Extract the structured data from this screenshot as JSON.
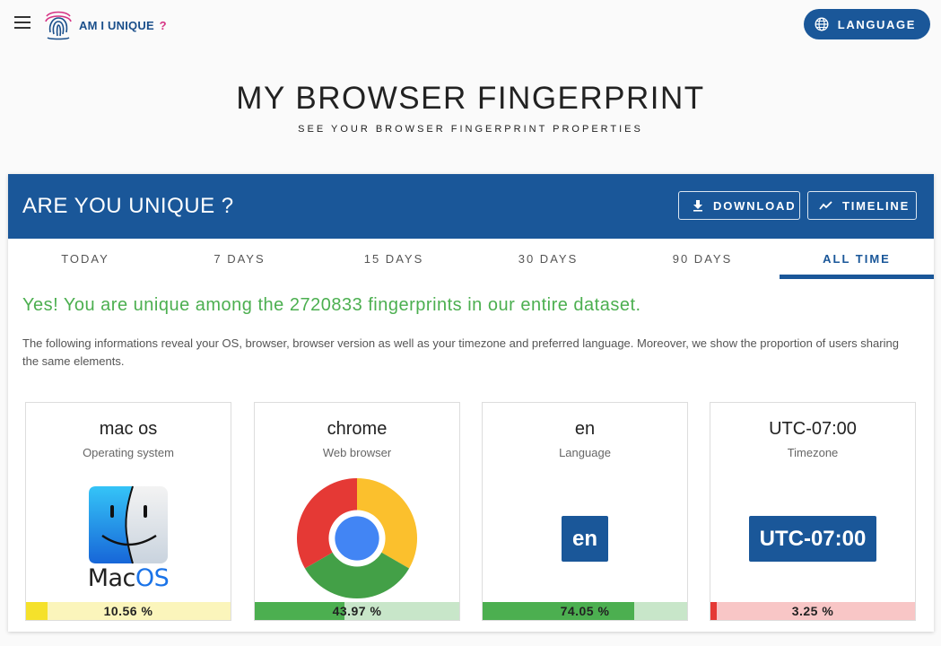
{
  "app": {
    "logo_text": "AM I UNIQUE",
    "logo_q": "?",
    "language_label": "LANGUAGE"
  },
  "hero": {
    "title": "MY BROWSER FINGERPRINT",
    "subtitle": "SEE YOUR BROWSER FINGERPRINT PROPERTIES"
  },
  "card": {
    "title": "ARE YOU UNIQUE ?",
    "download_label": "DOWNLOAD",
    "timeline_label": "TIMELINE",
    "tabs": [
      {
        "label": "TODAY"
      },
      {
        "label": "7 DAYS"
      },
      {
        "label": "15 DAYS"
      },
      {
        "label": "30 DAYS"
      },
      {
        "label": "90 DAYS"
      },
      {
        "label": "ALL TIME"
      }
    ],
    "active_tab": "ALL TIME",
    "message": "Yes! You are unique among the 2720833 fingerprints in our entire dataset.",
    "description": "The following informations reveal your OS, browser, browser version as well as your timezone and preferred language. Moreover, we show the proportion of users sharing the same elements."
  },
  "stats": [
    {
      "value": "mac os",
      "label": "Operating system",
      "visual": "macos-logo",
      "logo_word_mac": "Mac",
      "logo_word_os": "OS",
      "percent_text": "10.56 %",
      "percent": 10.56,
      "fill_color": "#f5e12b",
      "track_color": "#fbf5bb"
    },
    {
      "value": "chrome",
      "label": "Web browser",
      "visual": "chrome-logo",
      "percent_text": "43.97 %",
      "percent": 43.97,
      "fill_color": "#4caf50",
      "track_color": "#c8e6c9"
    },
    {
      "value": "en",
      "label": "Language",
      "visual": "badge",
      "badge_text": "en",
      "percent_text": "74.05 %",
      "percent": 74.05,
      "fill_color": "#4caf50",
      "track_color": "#c8e6c9"
    },
    {
      "value": "UTC-07:00",
      "label": "Timezone",
      "visual": "badge",
      "badge_text": "UTC-07:00",
      "percent_text": "3.25 %",
      "percent": 3.25,
      "fill_color": "#e53935",
      "track_color": "#f8c6c6"
    }
  ],
  "colors": {
    "primary": "#1a5799",
    "success_text": "#4caf50"
  }
}
